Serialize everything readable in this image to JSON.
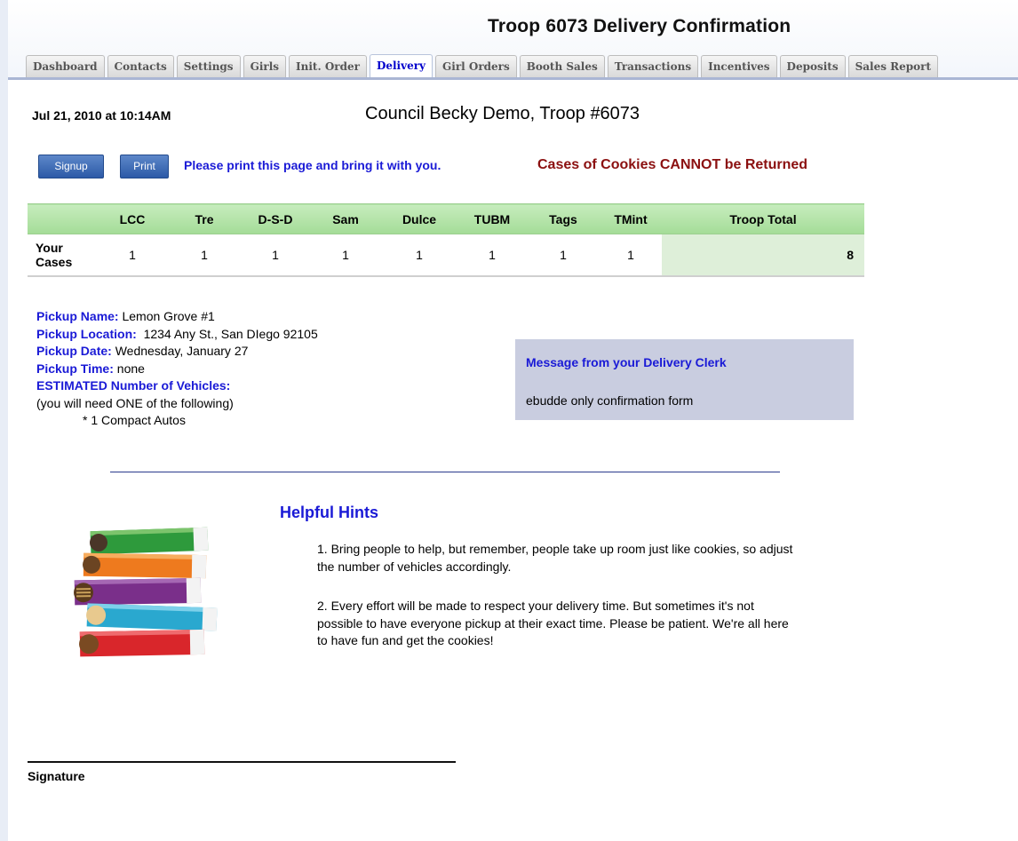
{
  "page": {
    "title": "Troop 6073 Delivery Confirmation"
  },
  "tabs": [
    {
      "label": "Dashboard",
      "active": false
    },
    {
      "label": "Contacts",
      "active": false
    },
    {
      "label": "Settings",
      "active": false
    },
    {
      "label": "Girls",
      "active": false
    },
    {
      "label": "Init. Order",
      "active": false
    },
    {
      "label": "Delivery",
      "active": true
    },
    {
      "label": "Girl Orders",
      "active": false
    },
    {
      "label": "Booth Sales",
      "active": false
    },
    {
      "label": "Transactions",
      "active": false
    },
    {
      "label": "Incentives",
      "active": false
    },
    {
      "label": "Deposits",
      "active": false
    },
    {
      "label": "Sales Report",
      "active": false
    }
  ],
  "header": {
    "datetime": "Jul 21, 2010 at 10:14AM",
    "council": "Council Becky Demo, Troop #6073"
  },
  "actions": {
    "signup_label": "Signup",
    "print_label": "Print",
    "print_message": "Please print this page and bring it with you.",
    "warning": "Cases of Cookies CANNOT be Returned"
  },
  "cases_table": {
    "columns": [
      "",
      "LCC",
      "Tre",
      "D-S-D",
      "Sam",
      "Dulce",
      "TUBM",
      "Tags",
      "TMint",
      "Troop Total"
    ],
    "row": {
      "label_line1": "Your",
      "label_line2": "Cases",
      "values": [
        "1",
        "1",
        "1",
        "1",
        "1",
        "1",
        "1",
        "1"
      ],
      "total": "8"
    }
  },
  "pickup": {
    "name_label": "Pickup Name:",
    "name_value": "Lemon Grove #1",
    "location_label": "Pickup Location:",
    "location_value": "1234 Any St., San DIego 92105",
    "date_label": "Pickup Date:",
    "date_value": "Wednesday, January 27",
    "time_label": "Pickup Time:",
    "time_value": "none",
    "vehicles_label": "ESTIMATED Number of Vehicles:",
    "vehicles_note": "(you will need ONE of the following)",
    "vehicles_item": "* 1 Compact Autos"
  },
  "message": {
    "title": "Message from your Delivery Clerk",
    "body": "ebudde only confirmation form"
  },
  "hints": {
    "title": "Helpful Hints",
    "hint1": "1. Bring people to help, but remember, people take up room just like cookies, so adjust the number of vehicles accordingly.",
    "hint2": "2. Every effort will be made to respect your delivery time. But sometimes it's not possible to have everyone pickup at their exact time. Please be patient. We're all here to have fun and get the cookies!"
  },
  "signature": {
    "label": "Signature"
  },
  "colors": {
    "link_blue": "#1a1ad6",
    "warning_red": "#8b1010",
    "table_header_green": "#b5e4aa",
    "message_box": "#c9cde0"
  }
}
